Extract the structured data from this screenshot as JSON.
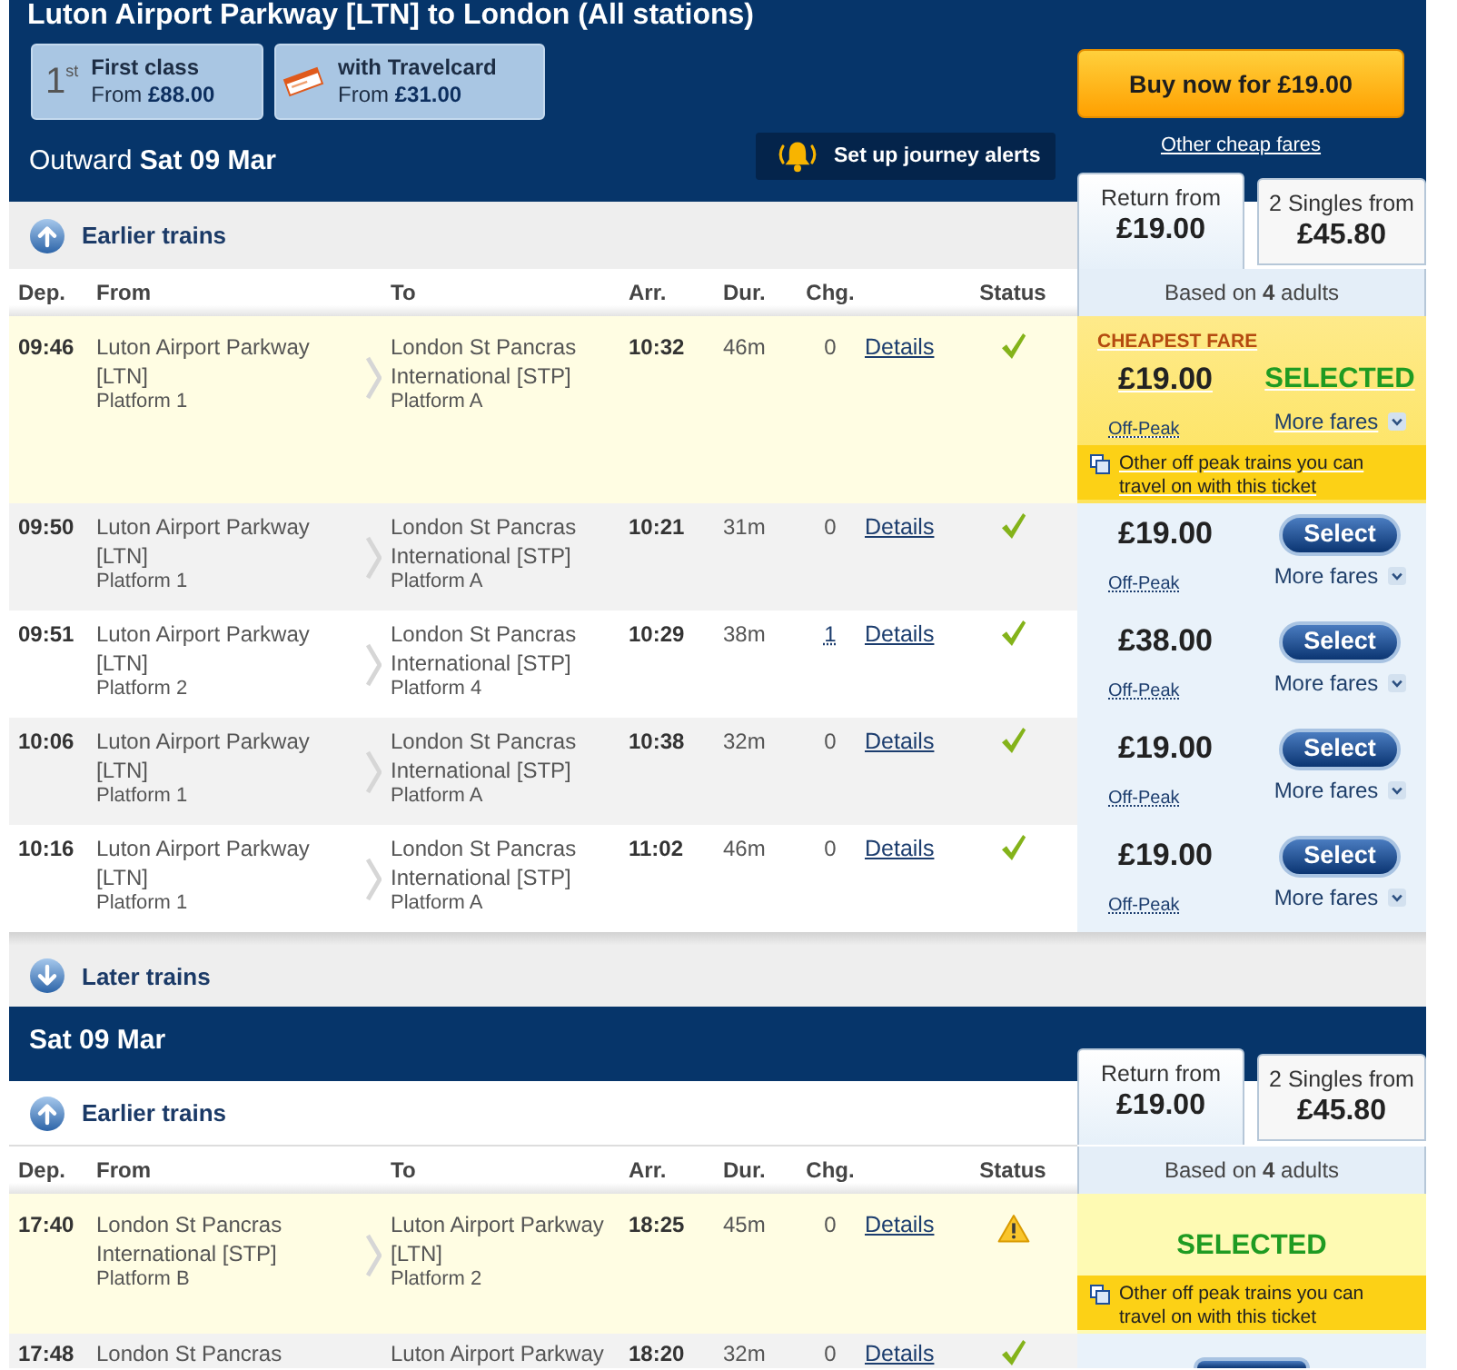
{
  "header": {
    "title": "Luton Airport Parkway [LTN] to London (All stations)",
    "upsells": [
      {
        "kind": "first_class",
        "badge": "1$^{st}$",
        "label": "First class",
        "price": "From **£88.00**"
      },
      {
        "kind": "travelcard",
        "label": "with Travelcard",
        "price": "From **£31.00**"
      }
    ],
    "buy_button": "Buy now for £19.00",
    "other_fares_link": "Other cheap fares",
    "alerts_button": "Set up journey alerts"
  },
  "outward": {
    "label": "Outward",
    "date": "Sat 09 Mar",
    "fare_tabs": [
      {
        "label": "Return from",
        "price": "£19.00",
        "selected": true
      },
      {
        "label": "2 Singles from",
        "price": "£45.80",
        "selected": false
      }
    ],
    "earlier_trains": "Earlier trains",
    "columns": [
      "Dep.",
      "From",
      "To",
      "Arr.",
      "Dur.",
      "Chg.",
      "Status"
    ],
    "basis": "Based on **4** adults",
    "rows": [
      {
        "dep": "09:46",
        "from": "Luton Airport Parkway [LTN]",
        "from_platform": "Platform 1",
        "to": "London St Pancras International [STP]",
        "to_platform": "Platform A",
        "arr": "10:32",
        "dur": "46m",
        "chg": "0",
        "chg_link": false,
        "details": "Details",
        "status": {
          "kind": "ok"
        },
        "selected": true,
        "fare": {
          "badge": "CHEAPEST FARE",
          "price": "£19.00",
          "action": "SELECTED",
          "fare_type": "Off-Peak",
          "more_fares": "More fares",
          "notice": "Other off peak trains you can travel on with this ticket"
        }
      },
      {
        "dep": "09:50",
        "from": "Luton Airport Parkway [LTN]",
        "from_platform": "Platform 1",
        "to": "London St Pancras International [STP]",
        "to_platform": "Platform A",
        "arr": "10:21",
        "dur": "31m",
        "chg": "0",
        "chg_link": false,
        "details": "Details",
        "status": {
          "kind": "ok"
        },
        "selected": false,
        "fare": {
          "price": "£19.00",
          "action": "Select",
          "fare_type": "Off-Peak",
          "more_fares": "More fares"
        }
      },
      {
        "dep": "09:51",
        "from": "Luton Airport Parkway [LTN]",
        "from_platform": "Platform 2",
        "to": "London St Pancras International [STP]",
        "to_platform": "Platform 4",
        "arr": "10:29",
        "dur": "38m",
        "chg": "1",
        "chg_link": true,
        "details": "Details",
        "status": {
          "kind": "ok"
        },
        "selected": false,
        "fare": {
          "price": "£38.00",
          "action": "Select",
          "fare_type": "Off-Peak",
          "more_fares": "More fares"
        }
      },
      {
        "dep": "10:06",
        "from": "Luton Airport Parkway [LTN]",
        "from_platform": "Platform 1",
        "to": "London St Pancras International [STP]",
        "to_platform": "Platform A",
        "arr": "10:38",
        "dur": "32m",
        "chg": "0",
        "chg_link": false,
        "details": "Details",
        "status": {
          "kind": "ok"
        },
        "selected": false,
        "fare": {
          "price": "£19.00",
          "action": "Select",
          "fare_type": "Off-Peak",
          "more_fares": "More fares"
        }
      },
      {
        "dep": "10:16",
        "from": "Luton Airport Parkway [LTN]",
        "from_platform": "Platform 1",
        "to": "London St Pancras International [STP]",
        "to_platform": "Platform A",
        "arr": "11:02",
        "dur": "46m",
        "chg": "0",
        "chg_link": false,
        "details": "Details",
        "status": {
          "kind": "ok"
        },
        "selected": false,
        "fare": {
          "price": "£19.00",
          "action": "Select",
          "fare_type": "Off-Peak",
          "more_fares": "More fares"
        }
      }
    ],
    "later_trains": "Later trains"
  },
  "return": {
    "date": "Sat 09 Mar",
    "fare_tabs": [
      {
        "label": "Return from",
        "price": "£19.00",
        "selected": true
      },
      {
        "label": "2 Singles from",
        "price": "£45.80",
        "selected": false
      }
    ],
    "earlier_trains": "Earlier trains",
    "columns": [
      "Dep.",
      "From",
      "To",
      "Arr.",
      "Dur.",
      "Chg.",
      "Status"
    ],
    "basis": "Based on **4** adults",
    "rows": [
      {
        "dep": "17:40",
        "from": "London St Pancras International [STP]",
        "from_platform": "Platform B",
        "to": "Luton Airport Parkway [LTN]",
        "to_platform": "Platform 2",
        "arr": "18:25",
        "dur": "45m",
        "chg": "0",
        "chg_link": false,
        "details": "Details",
        "status": {
          "kind": "warning"
        },
        "selected": true,
        "fare": {
          "action": "SELECTED",
          "notice": "Other off peak trains you can travel on with this ticket"
        }
      },
      {
        "dep": "17:48",
        "from": "London St Pancras",
        "to": "Luton Airport Parkway",
        "arr": "18:20",
        "dur": "32m",
        "chg": "0",
        "chg_link": false,
        "details": "Details",
        "status": {
          "kind": "ok"
        },
        "selected": false
      }
    ]
  }
}
